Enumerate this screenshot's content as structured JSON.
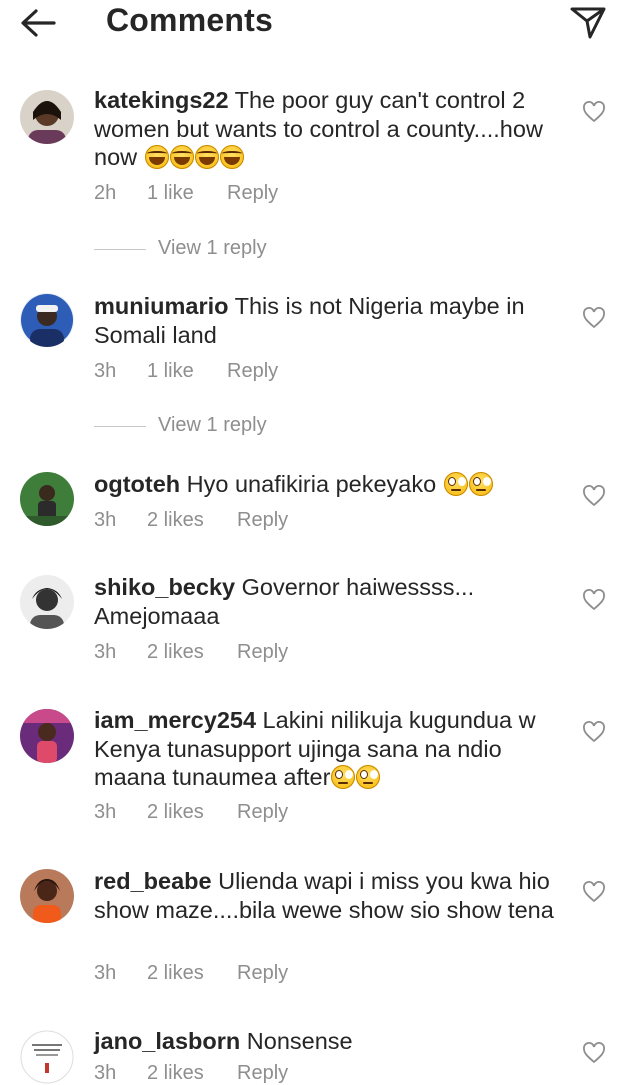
{
  "header": {
    "title": "Comments"
  },
  "comments": [
    {
      "user": "katekings22",
      "body": " The poor guy can't control 2 women but wants to control a county....how now ",
      "emoji": [
        "laugh",
        "laugh",
        "laugh",
        "laugh"
      ],
      "time": "2h",
      "likes": "1 like",
      "reply": "Reply",
      "view_replies": "View 1 reply"
    },
    {
      "user": "muniumario",
      "body": " This is not Nigeria maybe in Somali land",
      "emoji": [],
      "time": "3h",
      "likes": "1 like",
      "reply": "Reply",
      "view_replies": "View 1 reply"
    },
    {
      "user": "ogtoteh",
      "body": " Hyo unafikiria pekeyako ",
      "emoji": [
        "roll",
        "roll"
      ],
      "time": "3h",
      "likes": "2 likes",
      "reply": "Reply"
    },
    {
      "user": "shiko_becky",
      "body": " Governor haiwessss... Amejomaaa",
      "emoji": [],
      "time": "3h",
      "likes": "2 likes",
      "reply": "Reply"
    },
    {
      "user": "iam_mercy254",
      "body": " Lakini nilikuja kugundua w Kenya tunasupport ujinga sana na ndio maana tunaumea after",
      "emoji": [
        "roll",
        "roll"
      ],
      "time": "3h",
      "likes": "2 likes",
      "reply": "Reply"
    },
    {
      "user": "red_beabe",
      "body": " Ulienda wapi i miss you kwa hio show maze....bila wewe show sio show tena",
      "emoji": [],
      "time": "3h",
      "likes": "2 likes",
      "reply": "Reply"
    },
    {
      "user": "jano_lasborn",
      "body": " Nonsense",
      "emoji": [],
      "time": "3h",
      "likes": "2 likes",
      "reply": "Reply"
    }
  ]
}
